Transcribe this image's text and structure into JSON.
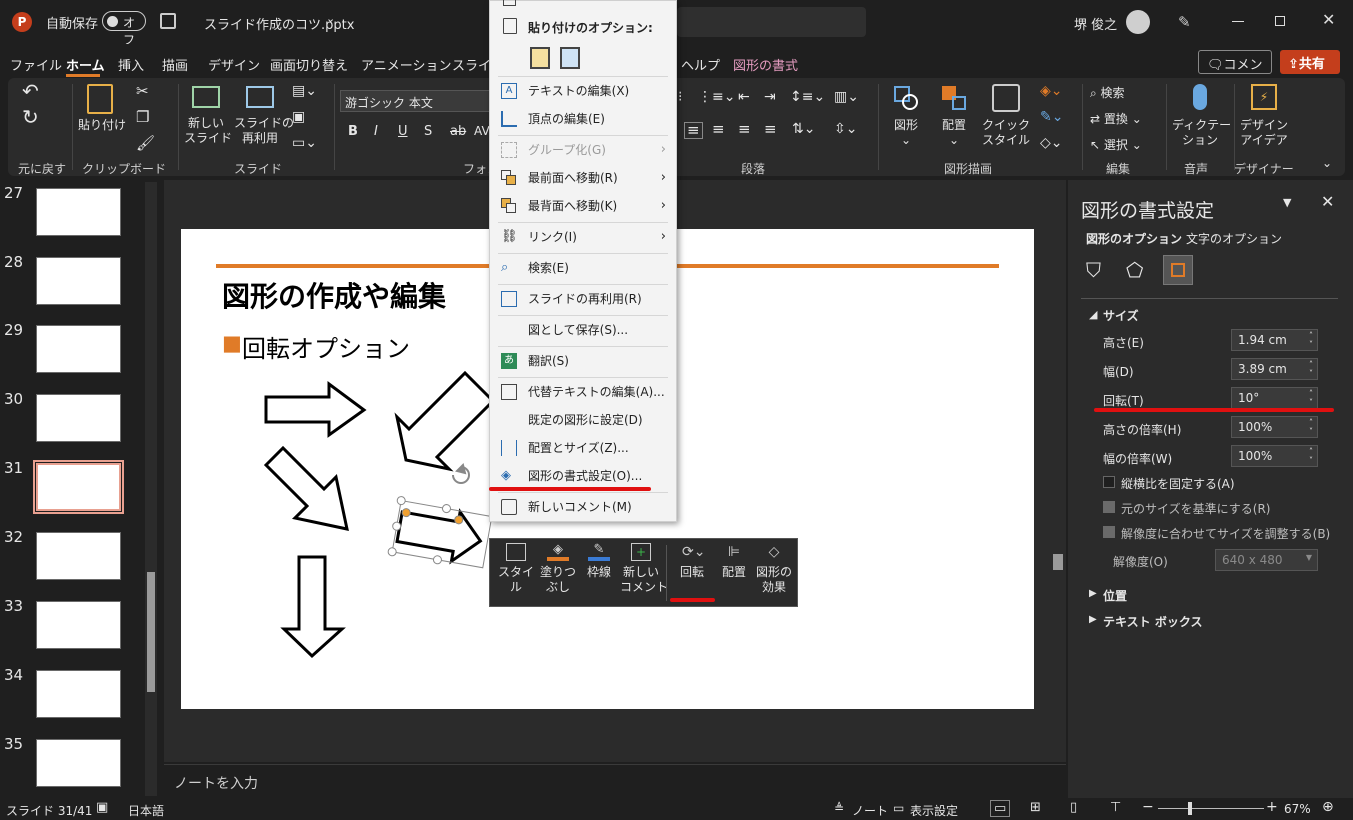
{
  "titlebar": {
    "autosave_label": "自動保存",
    "autosave_state": "オフ",
    "filename": "スライド作成のコツ.pptx",
    "filename_caret": "⌄",
    "user": "堺 俊之"
  },
  "menu": {
    "items": [
      "ファイル",
      "ホーム",
      "挿入",
      "描画",
      "デザイン",
      "画面切り替え",
      "アニメーション",
      "スライド",
      "ヘルプ",
      "図形の書式"
    ],
    "comment_btn": "コメント",
    "share_btn": "共有"
  },
  "ribbon": {
    "groups": [
      "元に戻す",
      "クリップボード",
      "スライド",
      "フォン",
      "段落",
      "図形描画",
      "編集",
      "音声",
      "デザイナー"
    ],
    "paste": "貼り付け",
    "new_slide": "新しい\nスライド",
    "reuse_slide": "スライドの\n再利用",
    "font_name": "游ゴシック 本文",
    "shape": "図形",
    "arrange": "配置",
    "quick_style": "クイック\nスタイル",
    "search": "検索",
    "replace": "置換",
    "select": "選択",
    "dictation": "ディクテー\nション",
    "designer": "デザイン\nアイデア"
  },
  "thumbnails": [
    {
      "num": "27"
    },
    {
      "num": "28"
    },
    {
      "num": "29"
    },
    {
      "num": "30"
    },
    {
      "num": "31"
    },
    {
      "num": "32"
    },
    {
      "num": "33"
    },
    {
      "num": "34"
    },
    {
      "num": "35"
    }
  ],
  "slide": {
    "title": "図形の作成や編集",
    "bullet": "■",
    "bullet_text": "回転オプション"
  },
  "notes_placeholder": "ノートを入力",
  "context_menu": {
    "paste_options": "貼り付けのオプション:",
    "items": [
      "テキストの編集(X)",
      "頂点の編集(E)",
      "グループ化(G)",
      "最前面へ移動(R)",
      "最背面へ移動(K)",
      "リンク(I)",
      "検索(E)",
      "スライドの再利用(R)",
      "図として保存(S)...",
      "翻訳(S)",
      "代替テキストの編集(A)...",
      "既定の図形に設定(D)",
      "配置とサイズ(Z)...",
      "図形の書式設定(O)...",
      "新しいコメント(M)"
    ]
  },
  "mini_toolbar": {
    "style": "スタイ\nル",
    "fill": "塗りつ\nぶし",
    "outline": "枠線",
    "new_comment": "新しい\nコメント",
    "rotate": "回転",
    "arrange": "配置",
    "effects": "図形の\n効果"
  },
  "format_pane": {
    "title": "図形の書式設定",
    "tab_shape": "図形のオプション",
    "tab_text": "文字のオプション",
    "section_size": "サイズ",
    "height_label": "高さ(E)",
    "height_value": "1.94 cm",
    "width_label": "幅(D)",
    "width_value": "3.89 cm",
    "rotation_label": "回転(T)",
    "rotation_value": "10°",
    "scale_h_label": "高さの倍率(H)",
    "scale_h_value": "100%",
    "scale_w_label": "幅の倍率(W)",
    "scale_w_value": "100%",
    "lock_aspect": "縦横比を固定する(A)",
    "relative_orig": "元のサイズを基準にする(R)",
    "best_scale": "解像度に合わせてサイズを調整する(B)",
    "resolution_label": "解像度(O)",
    "resolution_value": "640 x 480",
    "section_position": "位置",
    "section_textbox": "テキスト ボックス"
  },
  "status": {
    "slide": "スライド 31/41",
    "lang": "日本語",
    "notes": "ノート",
    "display_settings": "表示設定",
    "zoom": "67%"
  },
  "colors": {
    "accent_orange": "#e07b28",
    "share_red": "#c43e1c",
    "highlight_red": "#e01010"
  }
}
